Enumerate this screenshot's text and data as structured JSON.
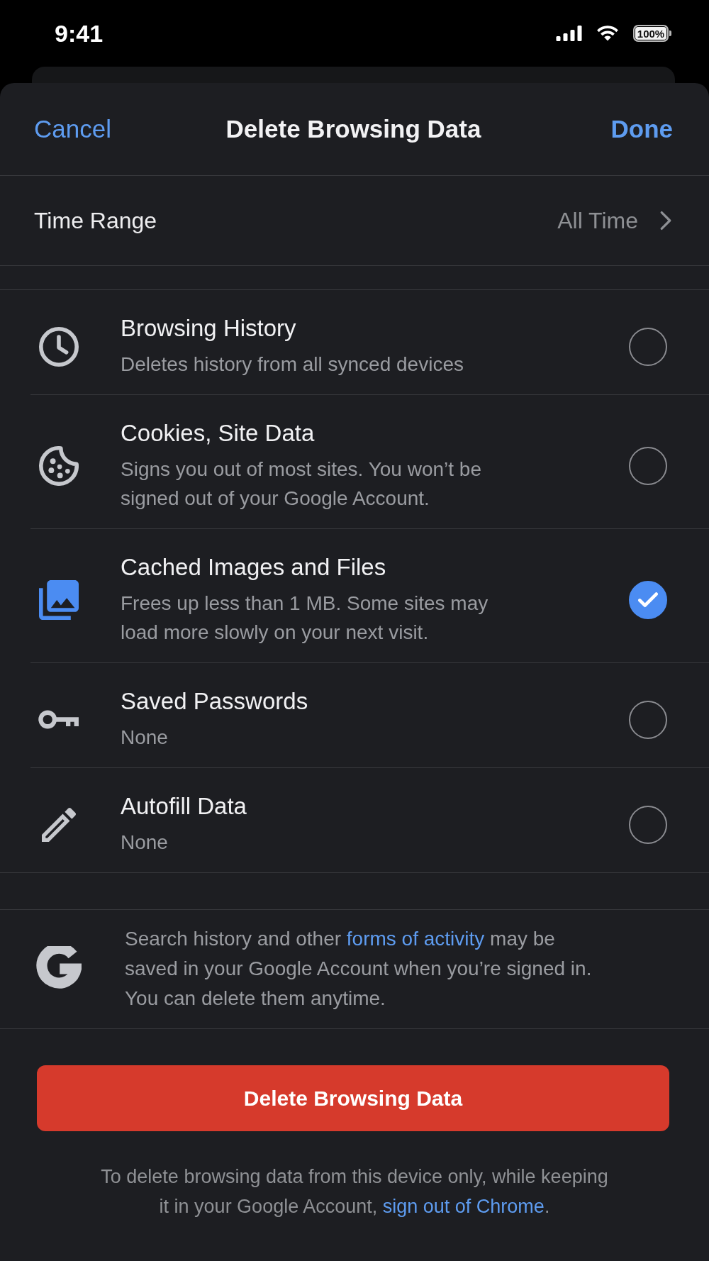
{
  "status_bar": {
    "time": "9:41",
    "battery": "100%"
  },
  "sheet": {
    "header": {
      "cancel": "Cancel",
      "title": "Delete Browsing Data",
      "done": "Done"
    },
    "time_range": {
      "label": "Time Range",
      "value": "All Time"
    },
    "items": [
      {
        "kind": "history",
        "title": "Browsing History",
        "subtitle": "Deletes history from all synced devices",
        "checked": false
      },
      {
        "kind": "cookies",
        "title": "Cookies, Site Data",
        "subtitle": "Signs you out of most sites. You won’t be\nsigned out of your Google Account.",
        "checked": false
      },
      {
        "kind": "cache",
        "title": "Cached Images and Files",
        "subtitle": "Frees up less than 1 MB. Some sites may\nload more slowly on your next visit.",
        "checked": true
      },
      {
        "kind": "passwords",
        "title": "Saved Passwords",
        "subtitle": "None",
        "checked": false
      },
      {
        "kind": "autofill",
        "title": "Autofill Data",
        "subtitle": "None",
        "checked": false
      }
    ],
    "info": {
      "text_before": "Search history and other ",
      "link": "forms of activity",
      "text_after": " may be\nsaved in your Google Account when you’re signed in.\nYou can delete them anytime."
    },
    "delete_button": "Delete Browsing Data",
    "footer": {
      "text_before": "To delete browsing data from this device only, while keeping\nit in your Google Account, ",
      "link": "sign out of Chrome",
      "text_after": "."
    }
  }
}
